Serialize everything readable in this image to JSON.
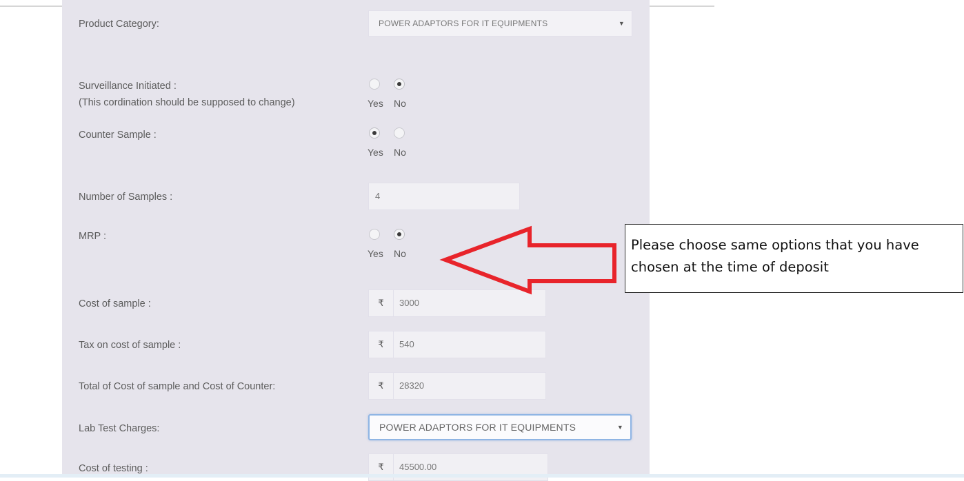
{
  "form": {
    "product_category": {
      "label": "Product Category:",
      "value": "POWER ADAPTORS FOR IT EQUIPMENTS"
    },
    "surveillance": {
      "label": "Surveillance Initiated :",
      "sublabel": "(This cordination should be supposed to change)",
      "options": [
        "Yes",
        "No"
      ],
      "selected": "No"
    },
    "counter_sample": {
      "label": "Counter Sample :",
      "options": [
        "Yes",
        "No"
      ],
      "selected": "Yes"
    },
    "number_of_samples": {
      "label": "Number of Samples :",
      "value": "4"
    },
    "mrp": {
      "label": "MRP :",
      "options": [
        "Yes",
        "No"
      ],
      "selected": "No"
    },
    "cost_of_sample": {
      "label": "Cost of sample :",
      "currency": "₹",
      "value": "3000"
    },
    "tax_on_cost": {
      "label": "Tax on cost of sample :",
      "currency": "₹",
      "value": "540"
    },
    "total_cost": {
      "label": "Total of Cost of sample and Cost of Counter:",
      "currency": "₹",
      "value": "28320"
    },
    "lab_test_charges": {
      "label": "Lab Test Charges:",
      "value": "POWER ADAPTORS FOR IT EQUIPMENTS"
    },
    "cost_of_testing": {
      "label": "Cost of testing :",
      "currency": "₹",
      "value": "45500.00"
    }
  },
  "callout": {
    "text": "Please choose same options that you have chosen at the time of deposit"
  },
  "colors": {
    "panel_bg": "#e6e4ec",
    "arrow_red": "#e8242b",
    "focus_border": "#8fb5e4"
  },
  "icons": {
    "dropdown": "caret-down-icon",
    "currency": "rupee-icon",
    "annotation": "arrow-left-icon"
  }
}
